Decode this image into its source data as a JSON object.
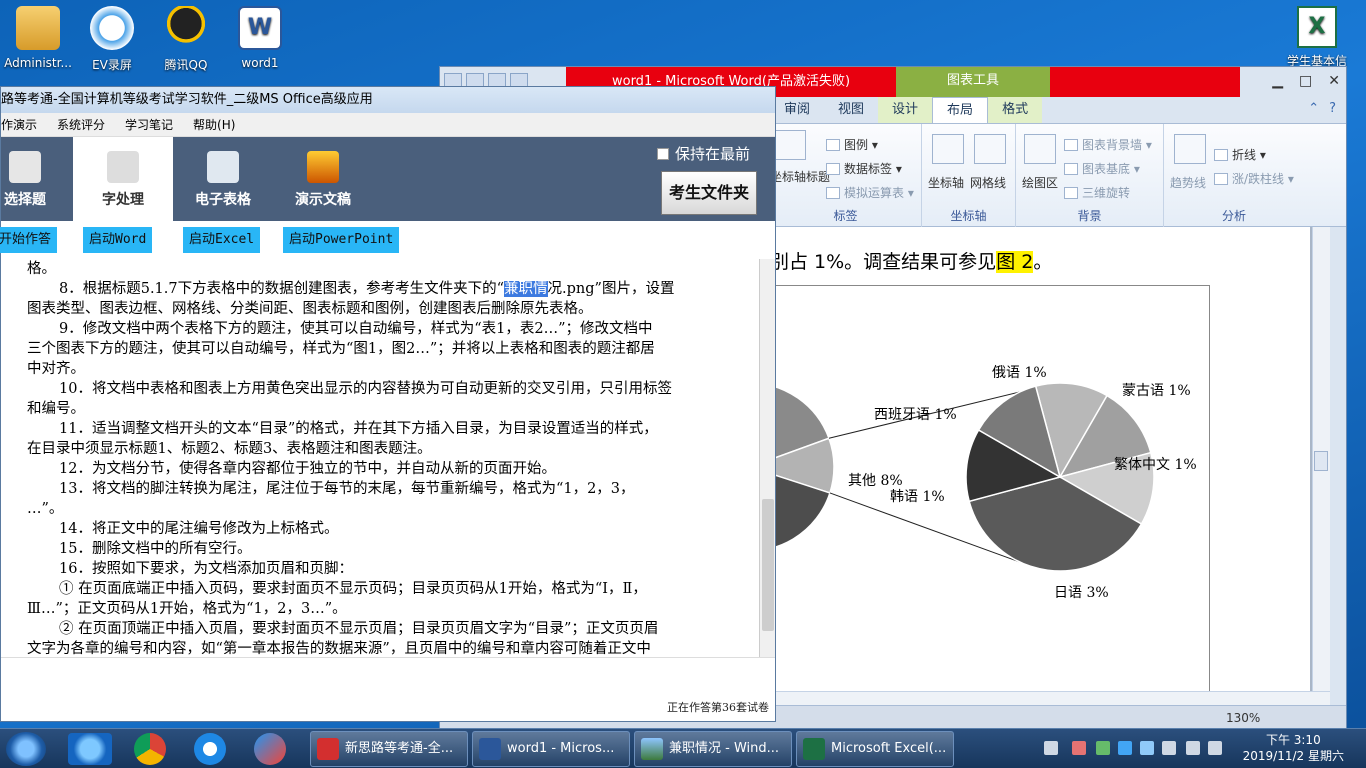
{
  "desktop": {
    "icons": [
      {
        "label": "Administr...",
        "icon": "user-folder-icon"
      },
      {
        "label": "EV录屏",
        "icon": "ev-recorder-icon"
      },
      {
        "label": "腾讯QQ",
        "icon": "qq-penguin-icon"
      },
      {
        "label": "word1",
        "icon": "word-document-icon"
      }
    ],
    "right_icon": {
      "label": "学生基本信",
      "icon": "excel-document-icon"
    }
  },
  "word": {
    "title": "word1 - Microsoft Word(产品激活失败)",
    "context_tools": "图表工具",
    "tabs": [
      "审阅",
      "视图",
      "设计",
      "布局",
      "格式"
    ],
    "active_tab": "布局",
    "ribbon": {
      "group_labels": {
        "label": "标签",
        "axes": "坐标轴",
        "background": "背景",
        "analysis": "分析"
      },
      "label_group": {
        "axis_title": "坐标轴标题",
        "legend": "图例",
        "data_labels": "数据标签",
        "data_table": "模拟运算表"
      },
      "axes_group": {
        "axes": "坐标轴",
        "gridlines": "网格线"
      },
      "bg_group": {
        "plot_area": "绘图区",
        "chart_wall": "图表背景墙",
        "chart_floor": "图表基底",
        "rotation": "三维旋转"
      },
      "analysis_group": {
        "trendline": "趋势线",
        "lines": "折线",
        "updown_bars": "涨/跌柱线"
      }
    },
    "doc": {
      "line_prefix": "别占 1%。调查结果可参见",
      "line_highlight": "图 2",
      "line_suffix": "。"
    },
    "statusbar": {
      "zoom": "130%"
    }
  },
  "chart_data": {
    "type": "pie",
    "title": "",
    "main_pie": {
      "labels": [
        "其他"
      ],
      "values": [
        8
      ]
    },
    "secondary_pie": {
      "labels": [
        "俄语",
        "蒙古语",
        "繁体中文",
        "日语",
        "韩语",
        "西班牙语"
      ],
      "values": [
        1,
        1,
        1,
        3,
        1,
        1
      ]
    },
    "data_labels": [
      {
        "text": "俄语 1%"
      },
      {
        "text": "蒙古语 1%"
      },
      {
        "text": "西班牙语 1%"
      },
      {
        "text": "繁体中文 1%"
      },
      {
        "text": "其他 8%"
      },
      {
        "text": "韩语 1%"
      },
      {
        "text": "日语 3%"
      }
    ]
  },
  "exam": {
    "title": "路等考通-全国计算机等级考试学习软件_二级MS Office高级应用",
    "menu": [
      "作演示",
      "系统评分",
      "学习笔记",
      "帮助(H)"
    ],
    "toolbar": {
      "tools": [
        "选择题",
        "字处理",
        "电子表格",
        "演示文稿"
      ],
      "active": "字处理",
      "keep_on_top": "保持在最前",
      "folder_button": "考生文件夹"
    },
    "actions": [
      "开始作答",
      "启动Word",
      "启动Excel",
      "启动PowerPoint"
    ],
    "content": {
      "l0": "格。",
      "l1a": "8．根据标题5.1.7下方表格中的数据创建图表，参考考生文件夹下的“",
      "l1sel": "兼职情",
      "l1b": "况.png”图片，设置",
      "l2": "图表类型、图表边框、网格线、分类间距、图表标题和图例，创建图表后删除原先表格。",
      "l3": "9．修改文档中两个表格下方的题注，使其可以自动编号，样式为“表1，表2…”；修改文档中",
      "l4": "三个图表下方的题注，使其可以自动编号，样式为“图1，图2…”；并将以上表格和图表的题注都居",
      "l5": "中对齐。",
      "l6": "10．将文档中表格和图表上方用黄色突出显示的内容替换为可自动更新的交叉引用，只引用标签",
      "l7": "和编号。",
      "l8": "11．适当调整文档开头的文本“目录”的格式，并在其下方插入目录，为目录设置适当的样式，",
      "l9": "在目录中须显示标题1、标题2、标题3、表格题注和图表题注。",
      "l10": "12．为文档分节，使得各章内容都位于独立的节中，并自动从新的页面开始。",
      "l11": "13．将文档的脚注转换为尾注，尾注位于每节的末尾，每节重新编号，格式为“1，2，3，",
      "l12": "…”。",
      "l13": "14．将正文中的尾注编号修改为上标格式。",
      "l14": "15．删除文档中的所有空行。",
      "l15": "16．按照如下要求，为文档添加页眉和页脚：",
      "l16": "① 在页面底端正中插入页码，要求封面页不显示页码；目录页页码从1开始，格式为“Ⅰ，Ⅱ，",
      "l17": "Ⅲ…”；正文页码从1开始，格式为“1，2，3…”。",
      "l18": "② 在页面顶端正中插入页眉，要求封面页不显示页眉；目录页页眉文字为“目录”；正文页页眉",
      "l19": "文字为各章的编号和内容，如“第一章本报告的数据来源”，且页眉中的编号和章内容可随着正文中"
    },
    "status": "正在作答第36套试卷"
  },
  "taskbar": {
    "tasks": [
      "新思路等考通-全...",
      "word1 - Micros...",
      "兼职情况 - Wind...",
      "Microsoft Excel(..."
    ],
    "clock_time": "下午 3:10",
    "clock_date": "2019/11/2 星期六"
  }
}
